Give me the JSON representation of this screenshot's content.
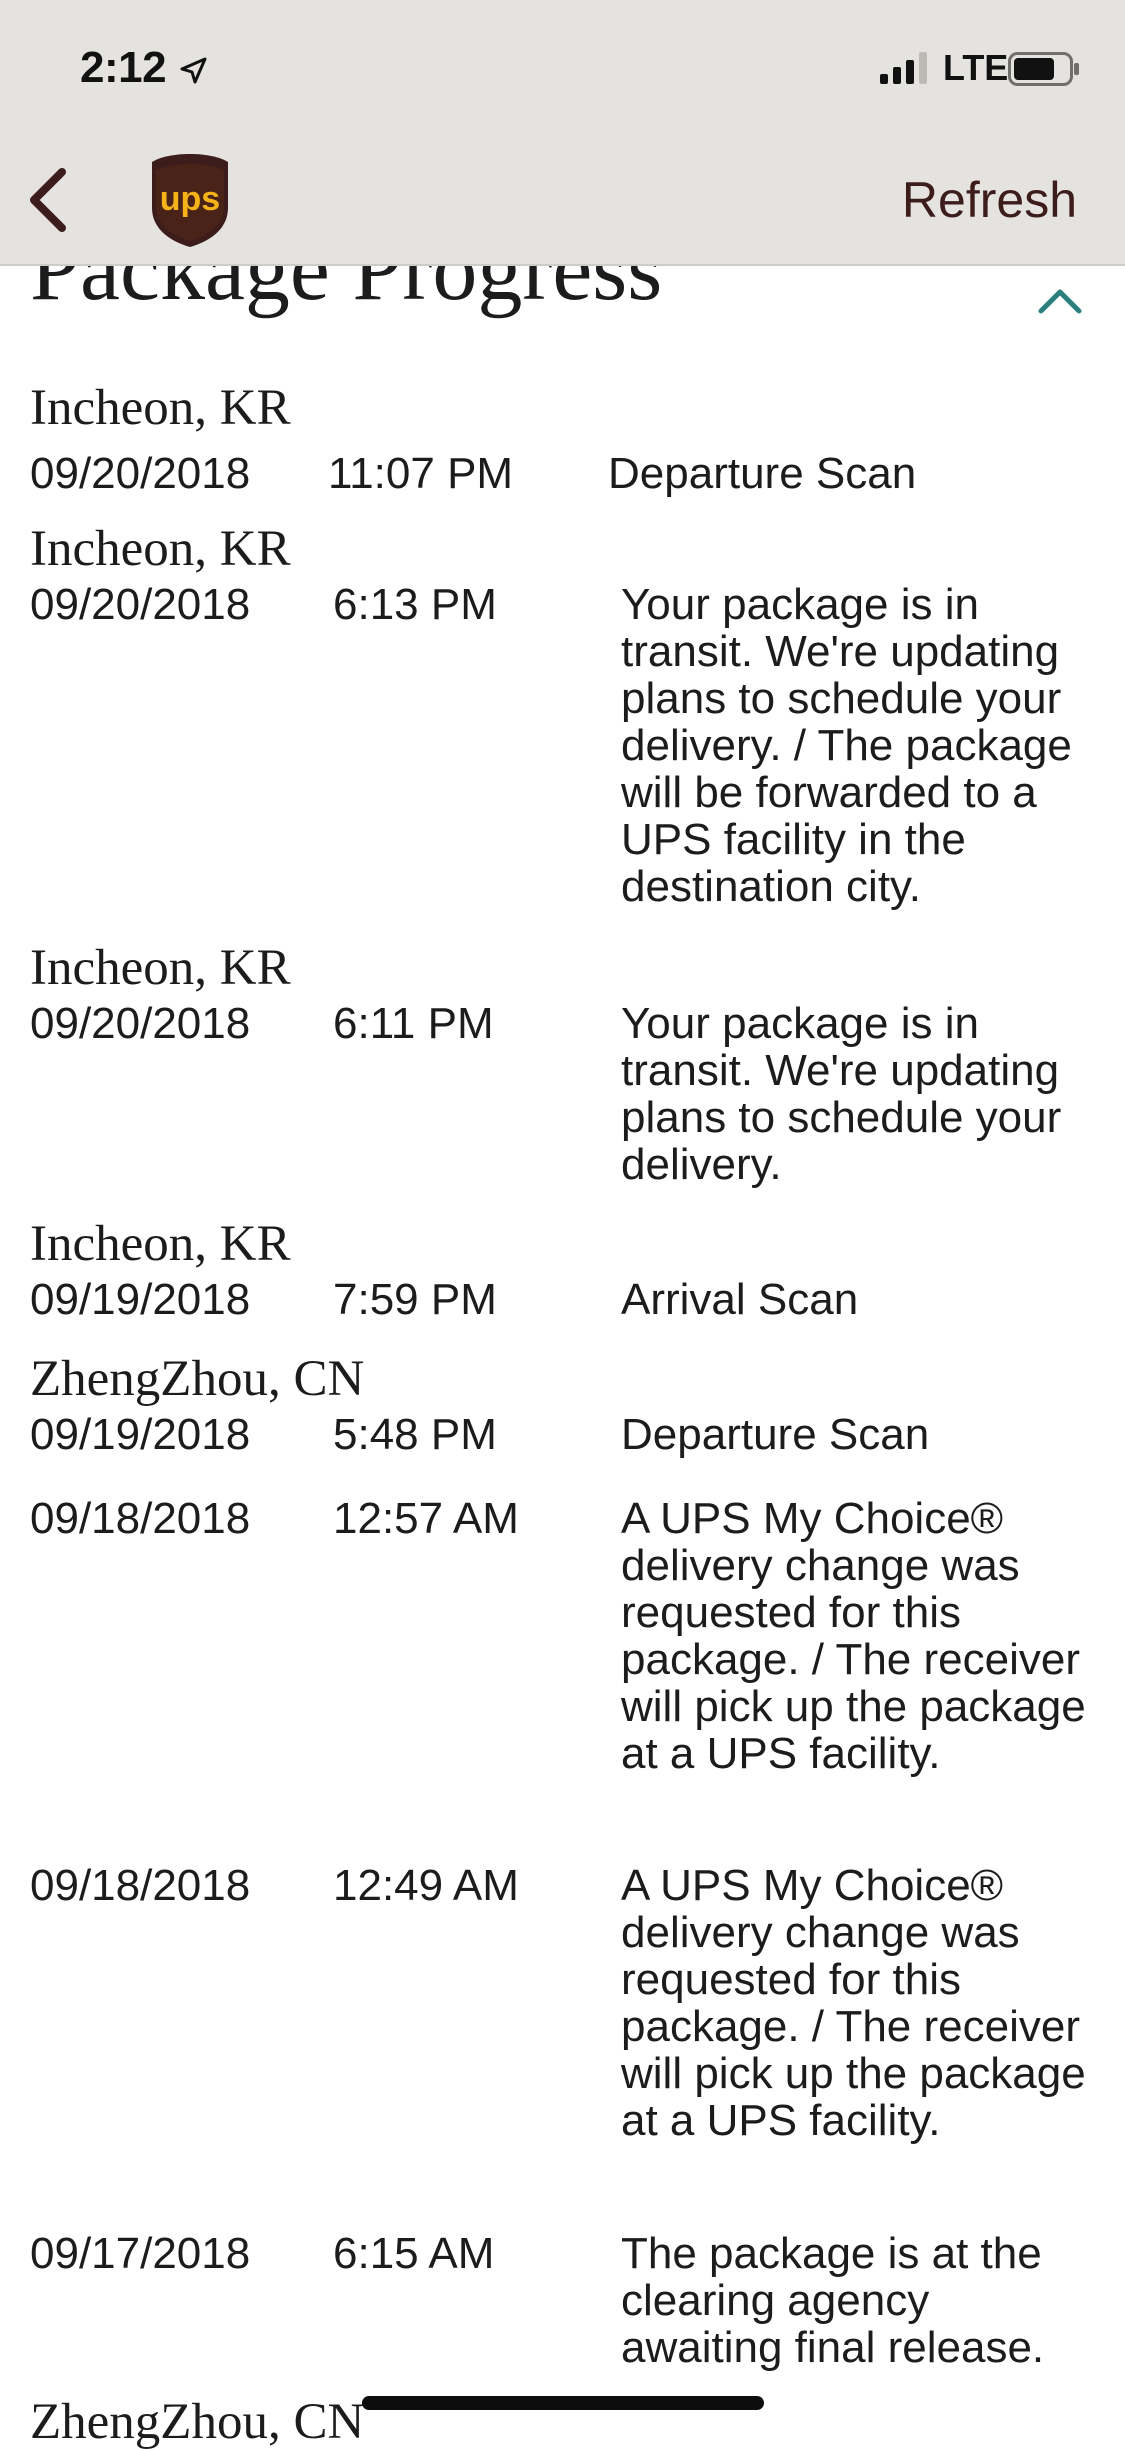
{
  "status_bar": {
    "time": "2:12",
    "network": "LTE"
  },
  "nav": {
    "refresh_label": "Refresh",
    "logo_text": "ups"
  },
  "section": {
    "title": "Package Progress"
  },
  "colors": {
    "nav_background": "#e5e3e0",
    "ups_brown": "#3d1c1c",
    "ups_gold": "#f6b318",
    "accent_teal": "#2a7f7d"
  },
  "events": [
    {
      "location": "Incheon, KR",
      "date": "09/20/2018",
      "time": "11:07 PM",
      "description": "Departure Scan"
    },
    {
      "location": "Incheon, KR",
      "date": "09/20/2018",
      "time": "6:13 PM",
      "description": "Your package is in transit. We're updating plans to schedule your delivery. / The package will be forwarded to a UPS facility in the destination city."
    },
    {
      "location": "Incheon, KR",
      "date": "09/20/2018",
      "time": "6:11 PM",
      "description": "Your package is in transit. We're updating plans to schedule your delivery."
    },
    {
      "location": "Incheon, KR",
      "date": "09/19/2018",
      "time": "7:59 PM",
      "description": "Arrival Scan"
    },
    {
      "location": "ZhengZhou, CN",
      "date": "09/19/2018",
      "time": "5:48 PM",
      "description": "Departure Scan"
    },
    {
      "location": "",
      "date": "09/18/2018",
      "time": "12:57 AM",
      "description": "A UPS My Choice® delivery change was requested for this package. / The receiver will pick up the package at a UPS facility."
    },
    {
      "location": "",
      "date": "09/18/2018",
      "time": "12:49 AM",
      "description": "A UPS My Choice® delivery change was requested for this package. / The receiver will pick up the package at a UPS facility."
    },
    {
      "location": "",
      "date": "09/17/2018",
      "time": "6:15 AM",
      "description": "The package is at the clearing agency awaiting final release."
    },
    {
      "location": "ZhengZhou, CN",
      "date": "",
      "time": "",
      "description": ""
    }
  ]
}
